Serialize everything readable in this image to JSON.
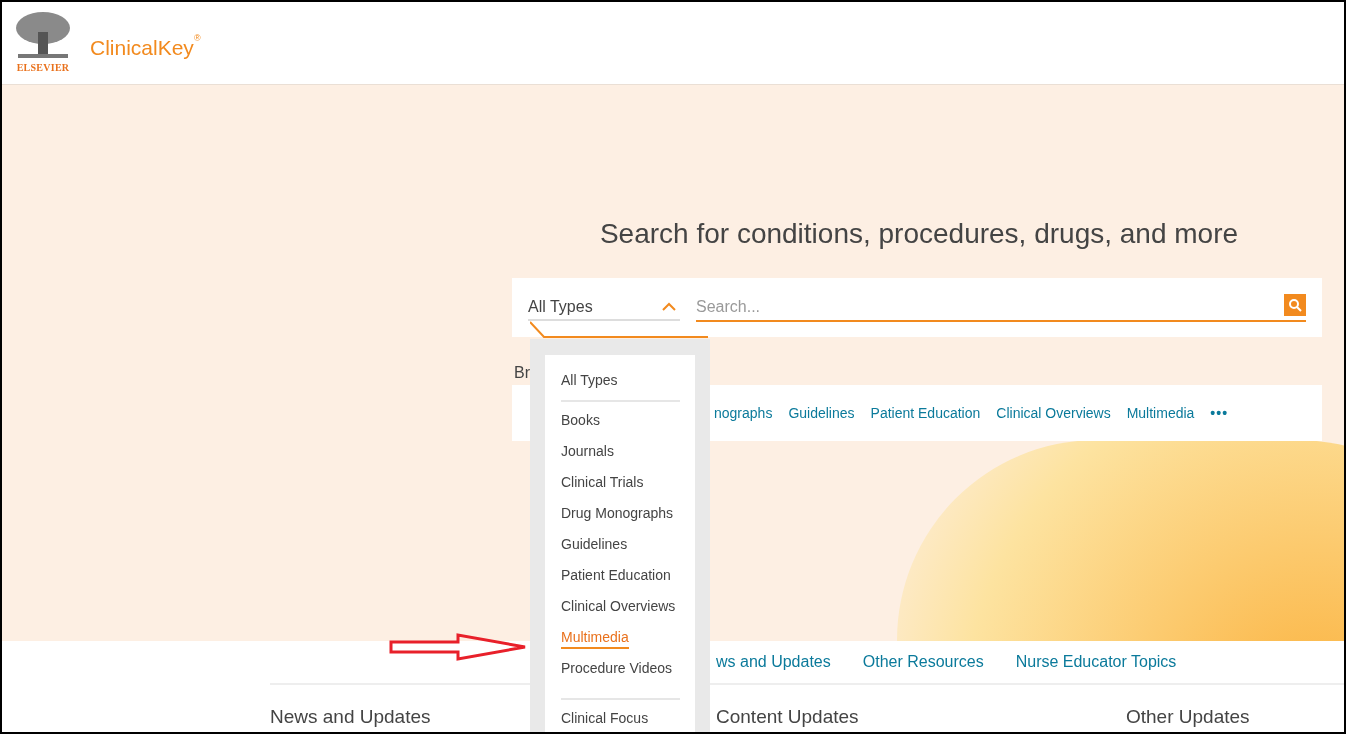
{
  "header": {
    "brand": "ClinicalKey",
    "brand_mark": "®",
    "publisher": "ELSEVIER"
  },
  "hero": {
    "heading": "Search for conditions, procedures, drugs, and more",
    "type_select": {
      "value": "All Types",
      "expanded": true
    },
    "search": {
      "placeholder": "Search..."
    },
    "browse_label": "Br",
    "browse_links": [
      "nographs",
      "Guidelines",
      "Patient Education",
      "Clinical Overviews",
      "Multimedia"
    ],
    "more": "•••"
  },
  "dropdown": {
    "groups": [
      [
        {
          "label": "All Types",
          "selected": false
        }
      ],
      [
        {
          "label": "Books",
          "selected": false
        },
        {
          "label": "Journals",
          "selected": false
        },
        {
          "label": "Clinical Trials",
          "selected": false
        },
        {
          "label": "Drug Monographs",
          "selected": false
        },
        {
          "label": "Guidelines",
          "selected": false
        },
        {
          "label": "Patient Education",
          "selected": false
        },
        {
          "label": "Clinical Overviews",
          "selected": false
        },
        {
          "label": "Multimedia",
          "selected": true
        },
        {
          "label": "Procedure Videos",
          "selected": false
        }
      ],
      [
        {
          "label": "Clinical Focus",
          "selected": false
        }
      ]
    ]
  },
  "section_tabs": [
    "ws and Updates",
    "Other Resources",
    "Nurse Educator Topics"
  ],
  "columns": [
    "News and Updates",
    "Content Updates",
    "Other Updates"
  ]
}
